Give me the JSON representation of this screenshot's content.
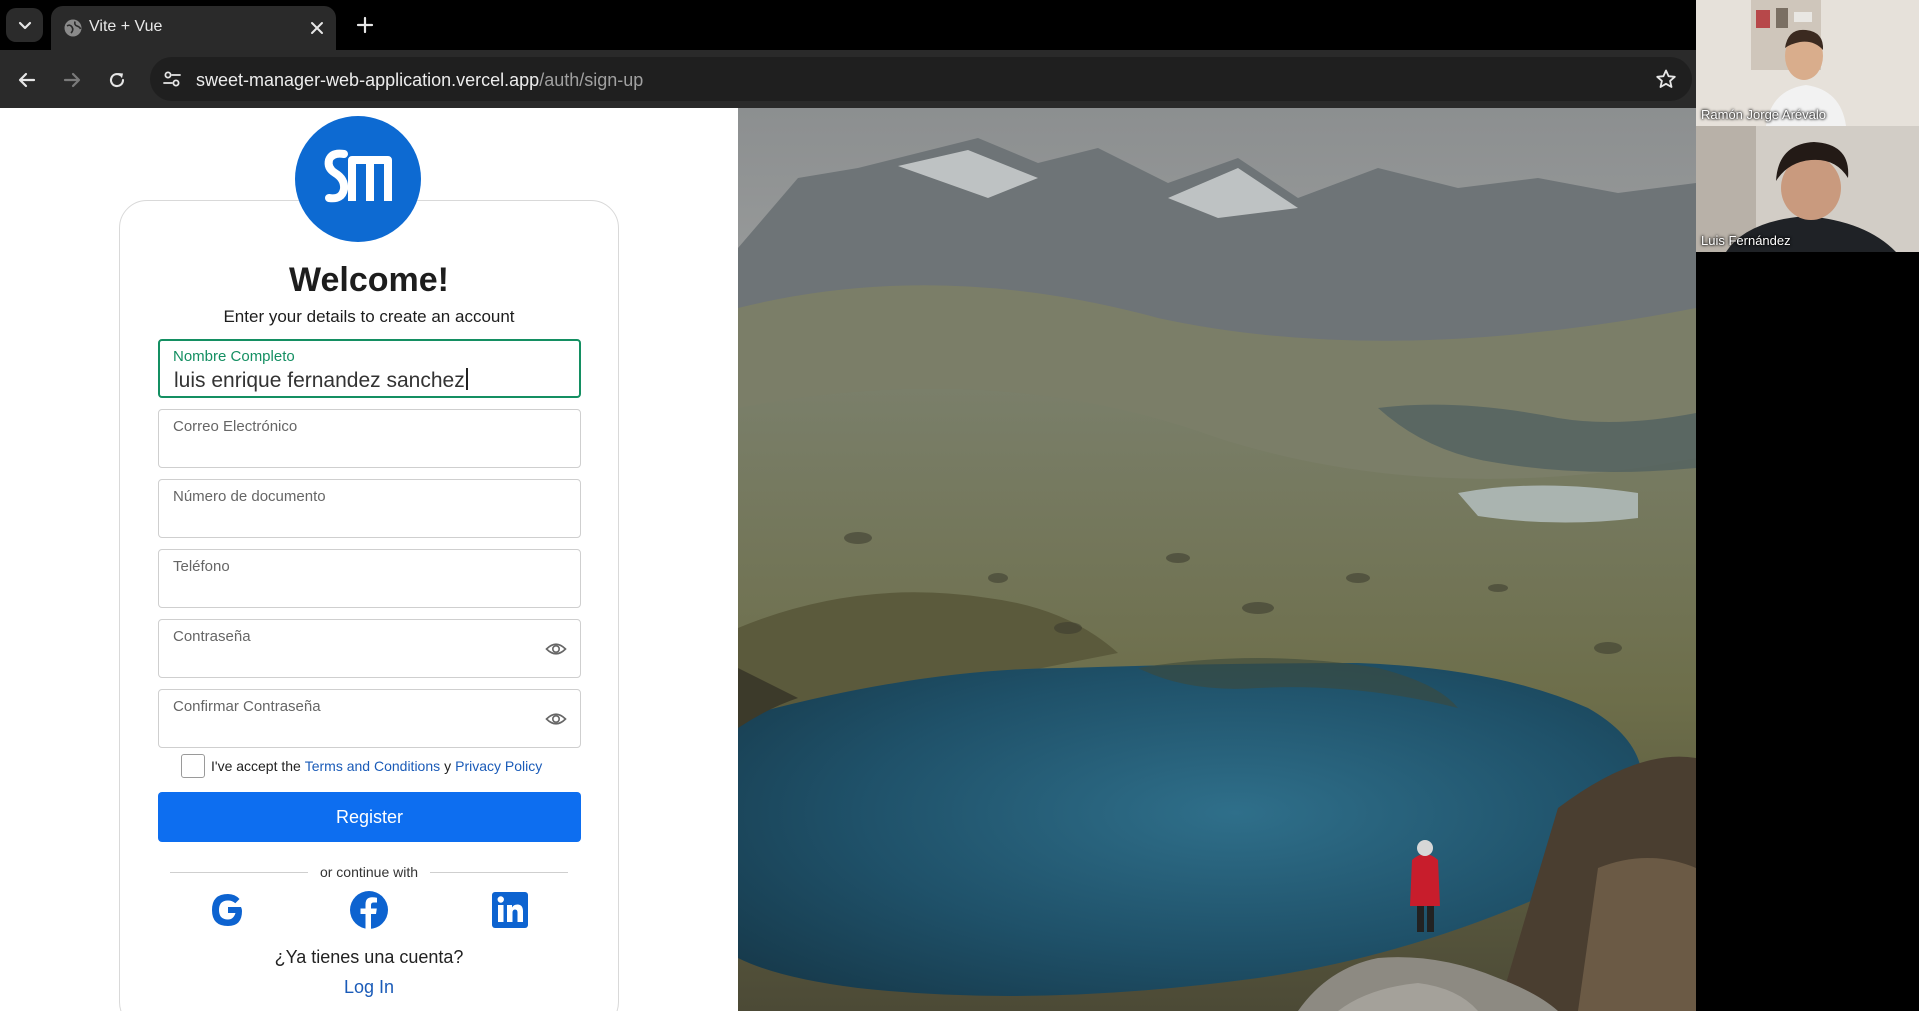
{
  "browser": {
    "tab_title": "Vite + Vue",
    "url_host": "sweet-manager-web-application.vercel.app",
    "url_path": "/auth/sign-up",
    "icons": [
      "tab-search-icon",
      "globe-icon",
      "close-icon",
      "plus-icon",
      "back-arrow-icon",
      "forward-arrow-icon",
      "reload-icon",
      "site-settings-icon",
      "star-icon"
    ]
  },
  "signup": {
    "heading": "Welcome!",
    "subtitle": "Enter your details to create an account",
    "fields": {
      "full_name": {
        "label": "Nombre Completo",
        "value": "luis enrique fernandez sanchez"
      },
      "email": {
        "label": "Correo Electrónico",
        "value": ""
      },
      "document": {
        "label": "Número de documento",
        "value": ""
      },
      "phone": {
        "label": "Teléfono",
        "value": ""
      },
      "password": {
        "label": "Contraseña",
        "value": ""
      },
      "confirm_password": {
        "label": "Confirmar Contraseña",
        "value": ""
      }
    },
    "terms": {
      "prefix": "I've accept the",
      "terms_link": "Terms and Conditions",
      "conjunction": "y",
      "privacy_link": "Privacy Policy",
      "checked": false
    },
    "register_button": "Register",
    "divider_text": "or continue with",
    "social": [
      "google-icon",
      "facebook-icon",
      "linkedin-icon"
    ],
    "have_account": "¿Ya tienes una cuenta?",
    "login_link": "Log In"
  },
  "video_call": {
    "participants": [
      {
        "name": "Ramón Jorge Arévalo"
      },
      {
        "name": "Luis Fernández"
      }
    ]
  },
  "colors": {
    "primary": "#0d6ef0",
    "logo": "#0d6ad2",
    "focus": "#148f62",
    "link": "#1a5bb8"
  }
}
